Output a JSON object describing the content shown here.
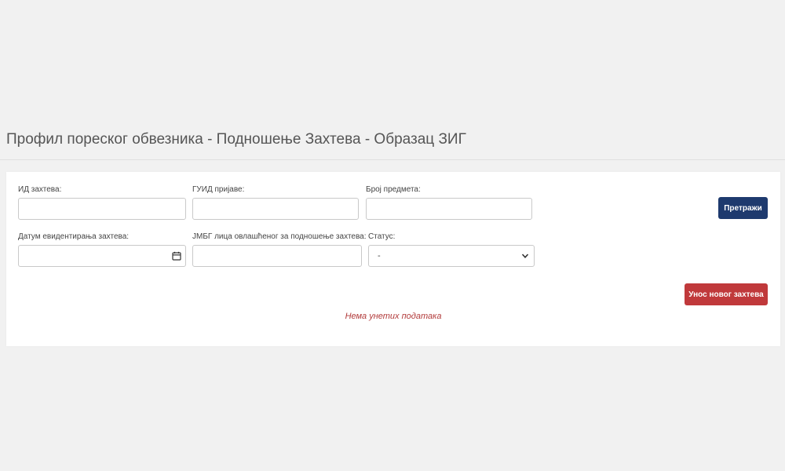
{
  "page": {
    "title": "Профил пореског обвезника - Подношење Захтева - Образац ЗИГ"
  },
  "filters": {
    "request_id": {
      "label": "ИД захтева:",
      "value": ""
    },
    "guid": {
      "label": "ГУИД пријаве:",
      "value": ""
    },
    "case_number": {
      "label": "Број предмета:",
      "value": ""
    },
    "record_date": {
      "label": "Датум евидентирања захтева:",
      "value": ""
    },
    "jmbg": {
      "label": "ЈМБГ лица овлашћеног за подношење захтева:",
      "value": ""
    },
    "status": {
      "label": "Статус:",
      "selected": "-"
    }
  },
  "actions": {
    "search_label": "Претражи",
    "new_request_label": "Унос новог захтева"
  },
  "results": {
    "empty_message": "Нема унетих података"
  },
  "colors": {
    "primary": "#1e3a6e",
    "danger": "#c0393b",
    "empty_text": "#b23b3b",
    "background": "#f1f1f1"
  },
  "icons": {
    "date_picker": "calendar-icon",
    "status_dropdown": "chevron-down-icon"
  }
}
